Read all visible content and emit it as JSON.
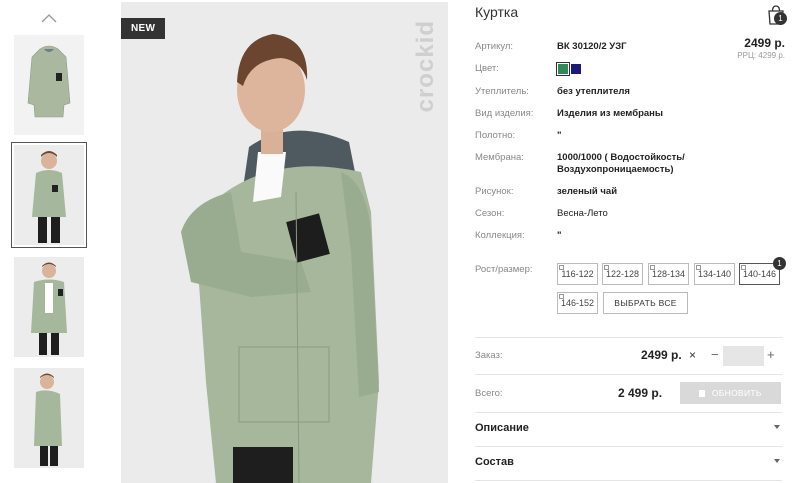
{
  "product": {
    "title": "Куртка",
    "badge": "NEW",
    "brand_vertical": "crockid",
    "cart_count": "1",
    "price": "2499 р.",
    "rrc": "РРЦ: 4299 р."
  },
  "specs": [
    {
      "label": "Артикул:",
      "value": "ВК 30120/2 УЗГ"
    },
    {
      "label": "Цвет:",
      "value": ""
    },
    {
      "label": "Утеплитель:",
      "value": "без утеплителя"
    },
    {
      "label": "Вид изделия:",
      "value": "Изделия из мембраны"
    },
    {
      "label": "Полотно:",
      "value": "\""
    },
    {
      "label": "Мембрана:",
      "value": "1000/1000 ( Водостойкость/ Воздухопроницаемость)"
    },
    {
      "label": "Рисунок:",
      "value": "зеленый чай"
    },
    {
      "label": "Сезон:",
      "value": "Весна-Лето"
    },
    {
      "label": "Коллекция:",
      "value": "\""
    }
  ],
  "colors": [
    "#2e8b57",
    "#1a1a7e"
  ],
  "sizes": {
    "label": "Рост/размер:",
    "options": [
      "116-122",
      "122-128",
      "128-134",
      "134-140",
      "140-146",
      "146-152"
    ],
    "selected": "140-146",
    "selected_count": "1",
    "select_all": "ВЫБРАТЬ ВСЕ"
  },
  "order": {
    "label": "Заказ:",
    "price": "2499 р.",
    "quantity": "",
    "minus": "−",
    "plus": "+",
    "remove": "×"
  },
  "total": {
    "label": "Всего:",
    "value": "2 499 р.",
    "update_button": "ОБНОВИТЬ"
  },
  "accordions": [
    {
      "title": "Описание"
    },
    {
      "title": "Состав"
    }
  ]
}
